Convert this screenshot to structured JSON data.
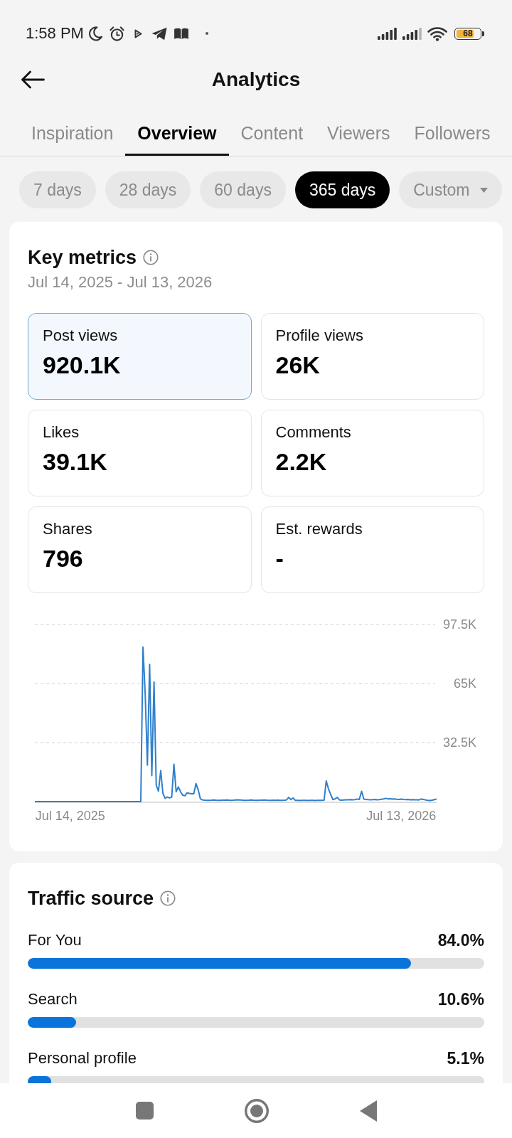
{
  "status_bar": {
    "time": "1:58 PM",
    "battery": "68"
  },
  "header": {
    "title": "Analytics"
  },
  "tabs": [
    {
      "label": "Inspiration",
      "selected": false
    },
    {
      "label": "Overview",
      "selected": true
    },
    {
      "label": "Content",
      "selected": false
    },
    {
      "label": "Viewers",
      "selected": false
    },
    {
      "label": "Followers",
      "selected": false
    }
  ],
  "date_ranges": [
    {
      "label": "7 days",
      "kind": "preset",
      "selected": false
    },
    {
      "label": "28 days",
      "kind": "preset",
      "selected": false
    },
    {
      "label": "60 days",
      "kind": "preset",
      "selected": false
    },
    {
      "label": "365 days",
      "kind": "preset",
      "selected": true
    },
    {
      "label": "Custom",
      "kind": "dropdown",
      "selected": false
    }
  ],
  "key_metrics": {
    "title": "Key metrics",
    "date_range": "Jul 14, 2025 - Jul 13, 2026",
    "metrics": [
      {
        "label": "Post views",
        "value": "920.1K",
        "selected": true
      },
      {
        "label": "Profile views",
        "value": "26K",
        "selected": false
      },
      {
        "label": "Likes",
        "value": "39.1K",
        "selected": false
      },
      {
        "label": "Comments",
        "value": "2.2K",
        "selected": false
      },
      {
        "label": "Shares",
        "value": "796",
        "selected": false
      },
      {
        "label": "Est. rewards",
        "value": "-",
        "selected": false
      }
    ],
    "chart_data": {
      "type": "line",
      "categories": [
        null,
        null,
        null,
        null,
        null,
        null,
        null,
        null,
        null,
        null,
        null,
        null,
        null,
        null,
        null,
        null,
        "Jul 14, 2025",
        null,
        null,
        null,
        null,
        null,
        null,
        null,
        null,
        null,
        null,
        null,
        null,
        null,
        null,
        null,
        null,
        null,
        null,
        null,
        null,
        null,
        null,
        null,
        null,
        null,
        null,
        null,
        null,
        null,
        null,
        null,
        null,
        null,
        null,
        null,
        null,
        null,
        null,
        null,
        null,
        null,
        null,
        null,
        null,
        null,
        null,
        null,
        null,
        null,
        null,
        null,
        null,
        null,
        null,
        null,
        null,
        null,
        null,
        null,
        null,
        null,
        null,
        null,
        null,
        null,
        null,
        null,
        null,
        null,
        null,
        null,
        null,
        null,
        null,
        null,
        null,
        null,
        null,
        null,
        null,
        null,
        null,
        null,
        null,
        null,
        null,
        null,
        null,
        null,
        null,
        null,
        null,
        null,
        null,
        null,
        null,
        null,
        null,
        null,
        null,
        null,
        null,
        null,
        null,
        null,
        null,
        null,
        null,
        null,
        null,
        null,
        null,
        null,
        null,
        null,
        null,
        null,
        null,
        null,
        null,
        null,
        null,
        null,
        null,
        null,
        null,
        null,
        null,
        null,
        null,
        null,
        null,
        null,
        null,
        null,
        null,
        null,
        null,
        null,
        null,
        null,
        null,
        null,
        null,
        null,
        null,
        null,
        null,
        null,
        "Jul 13, 2026",
        null,
        null,
        null,
        null,
        null,
        null,
        null,
        null,
        null,
        null,
        null,
        null,
        null,
        null,
        null,
        null
      ],
      "series": [
        {
          "color": "#2f80cc",
          "values": [
            0,
            0,
            0,
            0,
            0,
            0,
            0,
            0,
            0,
            0,
            0,
            0,
            0,
            0,
            0,
            0,
            0,
            0,
            0,
            0,
            0,
            0,
            0,
            0,
            0,
            0,
            0,
            0,
            0,
            0,
            0,
            0,
            0,
            0,
            0,
            0,
            0,
            0,
            0,
            0,
            0,
            0,
            0,
            0,
            0,
            0,
            0,
            0,
            0,
            85100,
            59100,
            20100,
            75600,
            14300,
            65900,
            9000,
            5700,
            17000,
            4500,
            1800,
            2500,
            2000,
            2500,
            20600,
            5400,
            8100,
            5400,
            3500,
            3200,
            4800,
            4500,
            4300,
            4300,
            9900,
            6500,
            1500,
            900,
            800,
            700,
            700,
            800,
            900,
            800,
            700,
            700,
            800,
            800,
            900,
            800,
            700,
            800,
            900,
            1000,
            900,
            800,
            700,
            700,
            800,
            900,
            800,
            700,
            700,
            800,
            800,
            900,
            800,
            700,
            700,
            800,
            700,
            800,
            700,
            700,
            800,
            900,
            2300,
            1100,
            2000,
            700,
            700,
            600,
            700,
            700,
            700,
            600,
            700,
            700,
            600,
            700,
            700,
            700,
            800,
            11300,
            7000,
            3900,
            1100,
            1500,
            2300,
            900,
            800,
            900,
            1000,
            1000,
            1100,
            1000,
            1100,
            1400,
            1200,
            5700,
            1400,
            1200,
            1100,
            1000,
            1100,
            1200,
            1000,
            1100,
            1300,
            1500,
            1800,
            1500,
            1600,
            1400,
            1500,
            1300,
            1200,
            1400,
            1200,
            1100,
            1200,
            1000,
            1100,
            1000,
            1000,
            900,
            1400,
            1200,
            900,
            700,
            600,
            800,
            1100,
            1400
          ]
        }
      ],
      "ylim": [
        0,
        97500
      ],
      "yticks": [
        {
          "value": 32500,
          "label": "32.5K"
        },
        {
          "value": 65000,
          "label": "65K"
        },
        {
          "value": 97500,
          "label": "97.5K"
        }
      ]
    }
  },
  "traffic_source": {
    "title": "Traffic source",
    "sources": [
      {
        "name": "For You",
        "percent": "84.0%",
        "level": 0.84
      },
      {
        "name": "Search",
        "percent": "10.6%",
        "level": 0.106
      },
      {
        "name": "Personal profile",
        "percent": "5.1%",
        "level": 0.051
      }
    ]
  }
}
